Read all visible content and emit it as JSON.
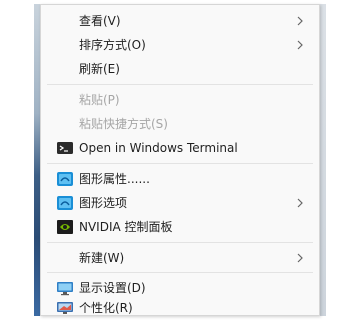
{
  "menu": {
    "items": [
      {
        "label": "查看(V)"
      },
      {
        "label": "排序方式(O)"
      },
      {
        "label": "刷新(E)"
      },
      {
        "label": "粘贴(P)"
      },
      {
        "label": "粘贴快捷方式(S)"
      },
      {
        "label": "Open in Windows Terminal",
        "icon": "terminal-icon"
      },
      {
        "label": "图形属性......",
        "icon": "intel-graphics-icon"
      },
      {
        "label": "图形选项",
        "icon": "intel-graphics-icon"
      },
      {
        "label": "NVIDIA 控制面板",
        "icon": "nvidia-icon"
      },
      {
        "label": "新建(W)"
      },
      {
        "label": "显示设置(D)",
        "icon": "display-icon"
      },
      {
        "label": "个性化(R)",
        "icon": "personalize-icon"
      }
    ],
    "submenu_glyph": "›"
  },
  "colors": {
    "menu_background": "#f9f9f9",
    "text": "#1f1f1f",
    "disabled_text": "#a6a6a6",
    "separator": "#e3e3e3"
  }
}
